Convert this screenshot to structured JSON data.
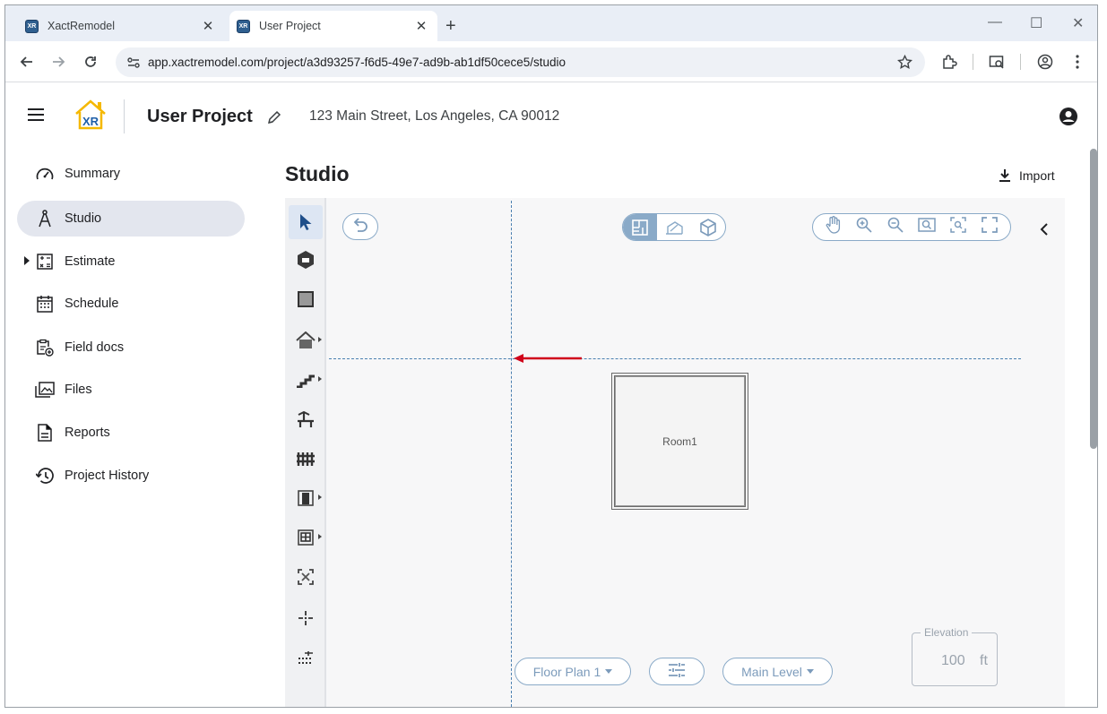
{
  "browser": {
    "tabs": [
      {
        "title": "XactRemodel",
        "favicon": "XR"
      },
      {
        "title": "User Project",
        "favicon": "XR"
      }
    ],
    "url": "app.xactremodel.com/project/a3d93257-f6d5-49e7-ad9b-ab1df50cece5/studio"
  },
  "header": {
    "logo_text": "XR",
    "project_title": "User Project",
    "address": "123 Main Street, Los Angeles, CA 90012"
  },
  "sidebar": {
    "items": [
      {
        "label": "Summary",
        "icon": "speedometer-icon"
      },
      {
        "label": "Studio",
        "icon": "compass-tool-icon",
        "selected": true
      },
      {
        "label": "Estimate",
        "icon": "calculator-icon",
        "expandable": true
      },
      {
        "label": "Schedule",
        "icon": "calendar-icon"
      },
      {
        "label": "Field docs",
        "icon": "clipboard-add-icon"
      },
      {
        "label": "Files",
        "icon": "photo-library-icon"
      },
      {
        "label": "Reports",
        "icon": "document-icon"
      },
      {
        "label": "Project History",
        "icon": "history-icon"
      }
    ]
  },
  "main": {
    "title": "Studio",
    "import_label": "Import"
  },
  "canvas": {
    "room_label": "Room1",
    "floor_plan_label": "Floor Plan 1",
    "level_label": "Main Level",
    "elevation_label": "Elevation",
    "elevation_value": "100",
    "elevation_unit": "ft"
  },
  "colors": {
    "accent": "#8aaac8",
    "guide": "#4a7fb0",
    "arrow": "#d0021b",
    "logo_yellow": "#f5b800",
    "logo_blue": "#1f5fa8"
  }
}
